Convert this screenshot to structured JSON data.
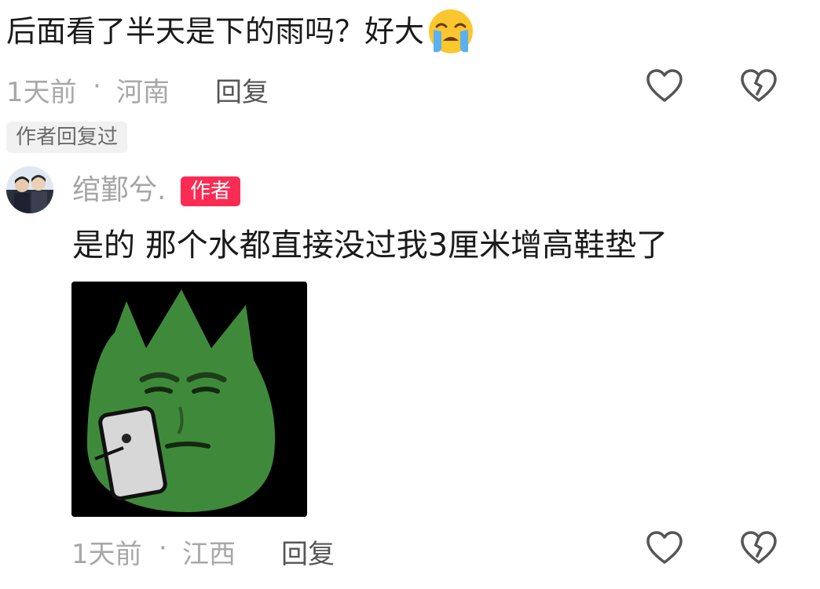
{
  "comment": {
    "text": "后面看了半天是下的雨吗？好大",
    "emoji": "loudly-crying-face-icon",
    "time": "1天前",
    "separator": "·",
    "location": "河南",
    "reply_label": "回复",
    "author_replied_tag": "作者回复过"
  },
  "reply": {
    "username": "绾鄞兮.",
    "author_badge": "作者",
    "text": "是的 那个水都直接没过我3厘米增高鞋垫了",
    "time": "1天前",
    "separator": "·",
    "location": "江西",
    "reply_label": "回复"
  },
  "colors": {
    "badge_red": "#fb2c54",
    "meta_gray": "#a8a8a8",
    "sticker_green": "#3f8a3a"
  }
}
